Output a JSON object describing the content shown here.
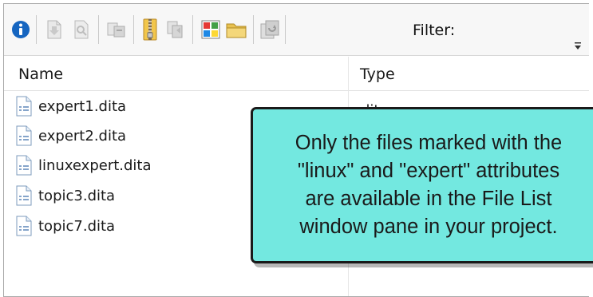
{
  "toolbar": {
    "buttons": [
      {
        "icon": "info-icon",
        "color": "#1565c0"
      },
      {
        "icon": "open-document-icon"
      },
      {
        "icon": "preview-icon"
      },
      {
        "icon": "check-out-icon"
      },
      {
        "icon": "zip-archive-icon",
        "color": "#d8a52b"
      },
      {
        "icon": "move-files-icon"
      },
      {
        "icon": "tile-view-icon"
      },
      {
        "icon": "folder-icon",
        "color": "#e8c150"
      },
      {
        "icon": "refresh-icon"
      }
    ],
    "filter_label": "Filter:"
  },
  "columns": {
    "name": "Name",
    "type": "Type"
  },
  "files": [
    {
      "name": "expert1.dita",
      "type": "dita"
    },
    {
      "name": "expert2.dita"
    },
    {
      "name": "linuxexpert.dita"
    },
    {
      "name": "topic3.dita"
    },
    {
      "name": "topic7.dita"
    }
  ],
  "callout": {
    "text": "Only the files marked with the\n\"linux\" and \"expert\" attributes\nare available in the File List\nwindow pane in your project.",
    "background": "#73e8e0"
  }
}
